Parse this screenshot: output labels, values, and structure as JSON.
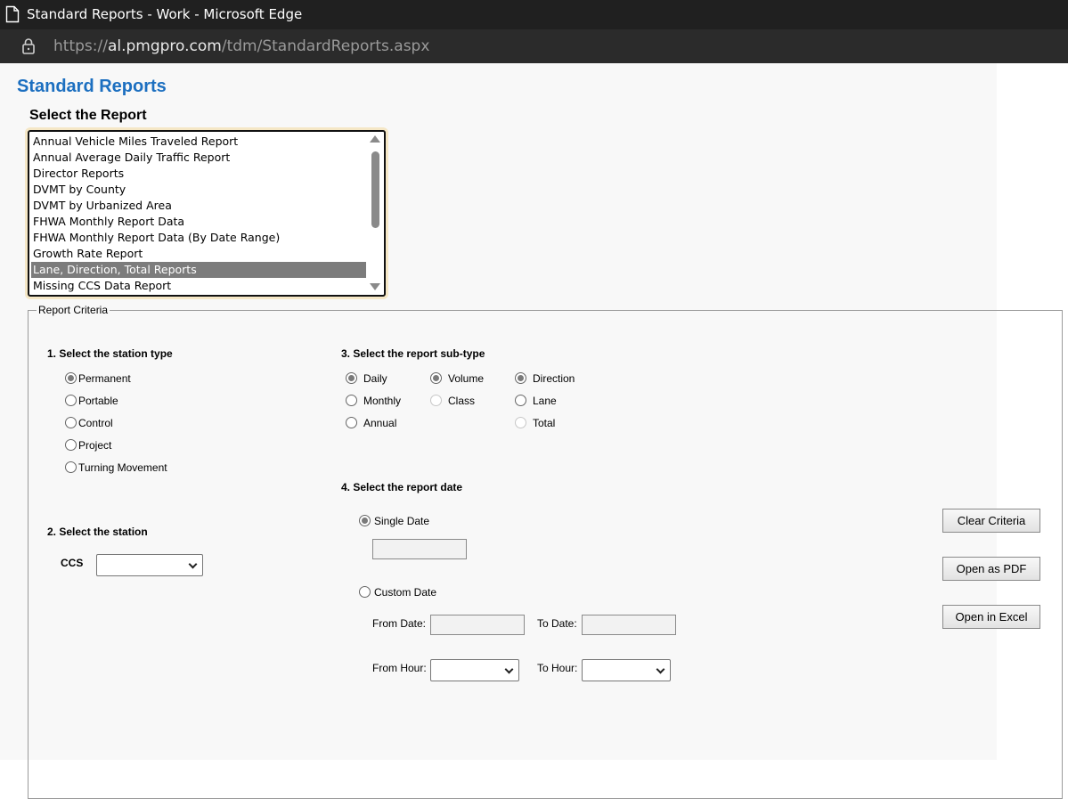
{
  "browser": {
    "window_title": "Standard Reports - Work - Microsoft Edge",
    "url_scheme": "https://",
    "url_host": "al.pmgpro.com",
    "url_path": "/tdm/StandardReports.aspx"
  },
  "page": {
    "title": "Standard Reports",
    "title_color": "#1c6fc0",
    "select_report_heading": "Select the Report"
  },
  "report_list": {
    "items": [
      "Annual Vehicle Miles Traveled Report",
      "Annual Average Daily Traffic Report",
      "Director Reports",
      "DVMT by County",
      "DVMT by Urbanized Area",
      "FHWA Monthly Report Data",
      "FHWA Monthly Report Data (By Date Range)",
      "Growth Rate Report",
      "Lane, Direction, Total Reports",
      "Missing CCS Data Report"
    ],
    "selected": "Lane, Direction, Total Reports"
  },
  "criteria": {
    "legend": "Report Criteria",
    "station_type": {
      "label": "1. Select the station type",
      "options": [
        "Permanent",
        "Portable",
        "Control",
        "Project",
        "Turning Movement"
      ],
      "selected": "Permanent"
    },
    "station": {
      "label": "2. Select the station",
      "ccs_label": "CCS",
      "ccs_value": ""
    },
    "sub_type": {
      "label": "3. Select the report sub-type",
      "period": {
        "options": [
          "Daily",
          "Monthly",
          "Annual"
        ],
        "selected": "Daily"
      },
      "measure": {
        "options": [
          "Volume",
          "Class"
        ],
        "selected": "Volume",
        "disabled": [
          "Class"
        ]
      },
      "grouping": {
        "options": [
          "Direction",
          "Lane",
          "Total"
        ],
        "selected": "Direction",
        "disabled": [
          "Total"
        ]
      }
    },
    "report_date": {
      "label": "4. Select the report date",
      "single_date_label": "Single Date",
      "single_date_value": "",
      "custom_date_label": "Custom Date",
      "selected": "Single Date",
      "from_date_label": "From Date:",
      "to_date_label": "To Date:",
      "from_hour_label": "From Hour:",
      "to_hour_label": "To Hour:"
    },
    "buttons": {
      "clear": "Clear Criteria",
      "pdf": "Open as PDF",
      "excel": "Open in Excel"
    }
  }
}
